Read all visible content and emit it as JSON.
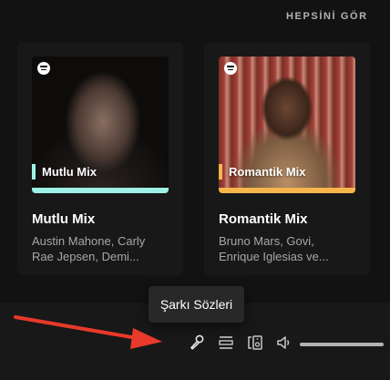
{
  "header": {
    "see_all": "HEPSİNİ GÖR"
  },
  "cards": [
    {
      "cover_label": "Mutlu Mix",
      "accent": "#9ff0e6",
      "title": "Mutlu Mix",
      "desc_line1": "Austin Mahone, Carly",
      "desc_line2": "Rae Jepsen, Demi..."
    },
    {
      "cover_label": "Romantik Mix",
      "accent": "#f6b64c",
      "title": "Romantik Mix",
      "desc_line1": "Bruno Mars, Govi,",
      "desc_line2": "Enrique Iglesias ve..."
    }
  ],
  "tooltip": {
    "text": "Şarkı Sözleri"
  },
  "controls": {
    "icons": [
      "microphone-icon",
      "queue-icon",
      "connect-device-icon",
      "volume-icon"
    ]
  },
  "colors": {
    "background": "#121212",
    "card": "#181818",
    "arrow": "#e8392a",
    "tooltip": "#282828"
  }
}
